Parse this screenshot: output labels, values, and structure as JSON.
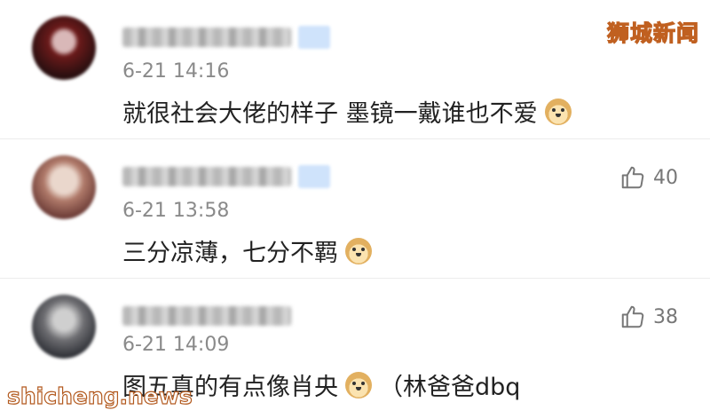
{
  "watermark": {
    "top": "狮城新闻",
    "bottom": "shicheng.news"
  },
  "comments": [
    {
      "time": "6-21 14:16",
      "text_before": "就很社会大佬的样子   墨镜一戴谁也不爱",
      "emoji": "doge-icon",
      "text_after": "",
      "likes": ""
    },
    {
      "time": "6-21 13:58",
      "text_before": "三分凉薄，七分不羁",
      "emoji": "doge-icon",
      "text_after": "",
      "likes": "40"
    },
    {
      "time": "6-21 14:09",
      "text_before": "图五真的有点像肖央",
      "emoji": "doge-icon",
      "text_after": "（林爸爸dbq",
      "likes": "38"
    }
  ]
}
